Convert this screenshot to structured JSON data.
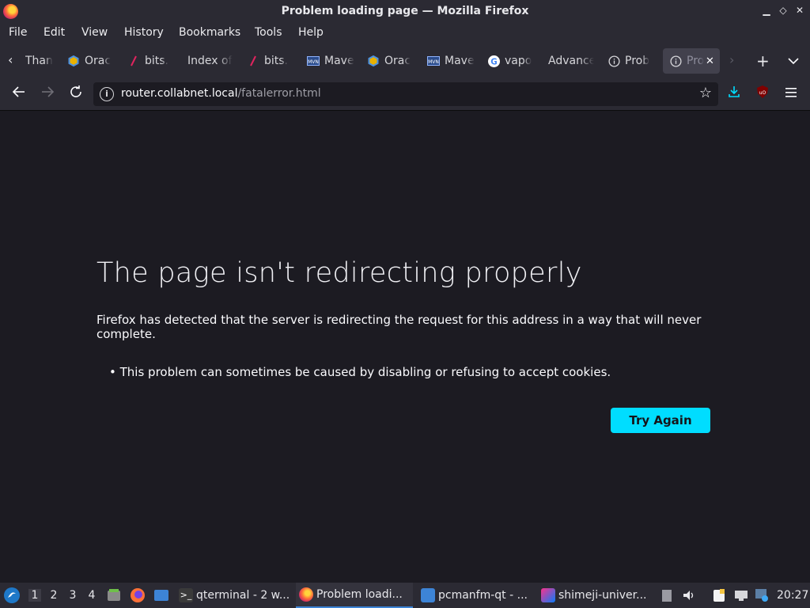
{
  "window": {
    "title": "Problem loading page — Mozilla Firefox"
  },
  "menu": [
    "File",
    "Edit",
    "View",
    "History",
    "Bookmarks",
    "Tools",
    "Help"
  ],
  "tabs": [
    {
      "label": "Than",
      "icon": "none"
    },
    {
      "label": "Orac",
      "icon": "oracle-icon"
    },
    {
      "label": "bits.",
      "icon": "pencil-icon"
    },
    {
      "label": "Index of",
      "icon": "none"
    },
    {
      "label": "bits.",
      "icon": "pencil-icon"
    },
    {
      "label": "Mave",
      "icon": "maven-icon"
    },
    {
      "label": "Orac",
      "icon": "oracle-icon"
    },
    {
      "label": "Mave",
      "icon": "maven-icon"
    },
    {
      "label": "vapo",
      "icon": "google-icon"
    },
    {
      "label": "Advance",
      "icon": "none"
    },
    {
      "label": "Prob",
      "icon": "info-icon"
    },
    {
      "label": "Pro",
      "icon": "info-icon",
      "active": true
    }
  ],
  "navbar": {
    "url_host": "router.collabnet.local",
    "url_path": "/fatalerror.html"
  },
  "error": {
    "title": "The page isn't redirecting properly",
    "description": "Firefox has detected that the server is redirecting the request for this address in a way that will never complete.",
    "bullet": "This problem can sometimes be caused by disabling or refusing to accept cookies.",
    "button": "Try Again"
  },
  "taskbar": {
    "workspaces": [
      "1",
      "2",
      "3",
      "4"
    ],
    "tasks": [
      {
        "label": "qterminal - 2 w...",
        "icon": "terminal-icon"
      },
      {
        "label": "Problem loadi...",
        "icon": "firefox-icon"
      },
      {
        "label": "pcmanfm-qt - ...",
        "icon": "folder-icon"
      },
      {
        "label": "shimeji-univer...",
        "icon": "intellij-icon"
      }
    ],
    "clock": "20:27"
  }
}
